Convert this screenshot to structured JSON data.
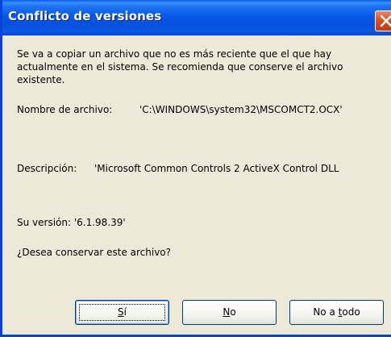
{
  "dialog": {
    "title": "Conflicto de versiones",
    "message_lines": [
      "Se va a copiar un archivo que no es más reciente que el que hay",
      "actualmente en el sistema. Se recomienda que conserve el archivo",
      "existente."
    ],
    "filename_label": "Nombre de archivo:",
    "filename_value": "'C:\\WINDOWS\\system32\\MSCOMCT2.OCX'",
    "description_label": "Descripción:",
    "description_value": "'Microsoft Common Controls 2 ActiveX Control DLL",
    "version_text": "Su versión: '6.1.98.39'",
    "question": "¿Desea conservar este archivo?"
  },
  "buttons": {
    "yes": {
      "mnemonic": "S",
      "rest": "í"
    },
    "no": {
      "mnemonic": "N",
      "rest": "o"
    },
    "no_to_all": {
      "before": "No a ",
      "mnemonic": "t",
      "rest": "odo"
    }
  },
  "icons": {
    "close": "close-icon"
  }
}
